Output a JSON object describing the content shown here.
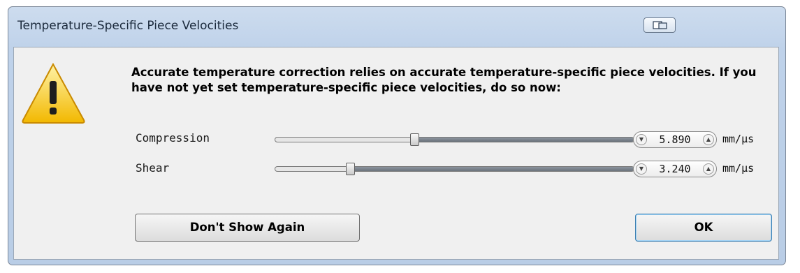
{
  "window": {
    "title": "Temperature-Specific Piece Velocities"
  },
  "icons": {
    "warning": "warning-icon",
    "restore": "restore-window-icon"
  },
  "message": "Accurate temperature correction relies on accurate temperature-specific piece velocities.  If you have not yet set temperature-specific piece velocities, do so now:",
  "rows": [
    {
      "label": "Compression",
      "value": "5.890",
      "unit": "mm/µs",
      "slider_fraction": 0.39
    },
    {
      "label": "Shear",
      "value": "3.240",
      "unit": "mm/µs",
      "slider_fraction": 0.21
    }
  ],
  "buttons": {
    "dont_show": "Don't Show Again",
    "ok": "OK"
  },
  "colors": {
    "accent": "#3c7fb1",
    "warning_yellow": "#f5c400"
  }
}
